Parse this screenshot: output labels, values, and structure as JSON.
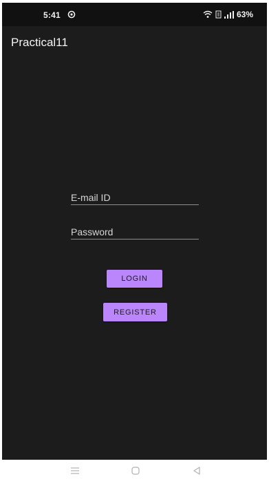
{
  "status_bar": {
    "time": "5:41",
    "battery": "63%",
    "icons": [
      "sync-icon",
      "wifi-icon",
      "sim-icon",
      "signal-icon"
    ]
  },
  "app": {
    "title": "Practical11"
  },
  "form": {
    "email_placeholder": "E-mail ID",
    "password_placeholder": "Password",
    "login_label": "LOGIN",
    "register_label": "REGISTER"
  },
  "nav_bar": {
    "icons": [
      "menu-icon",
      "home-icon",
      "back-icon"
    ]
  },
  "colors": {
    "background": "#1c1c1c",
    "status_bar": "#111111",
    "button": "#bb86fc",
    "underline": "#8e8e8e"
  }
}
